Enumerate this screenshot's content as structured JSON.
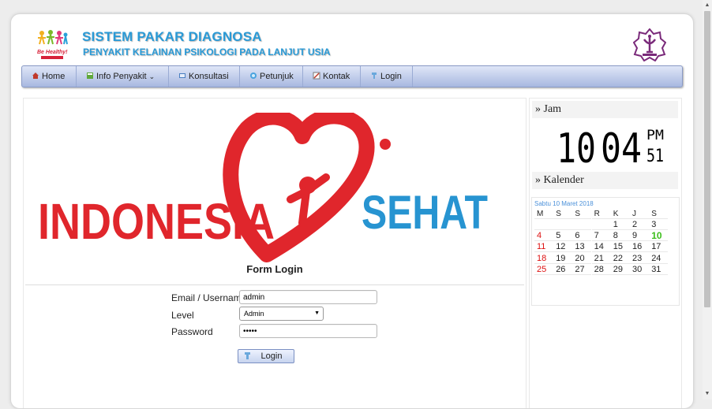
{
  "header": {
    "logo_left_text": "Be Healthy!",
    "title": "SISTEM PAKAR DIAGNOSA",
    "subtitle": "PENYAKIT KELAINAN PSIKOLOGI PADA LANJUT USIA"
  },
  "nav": {
    "items": [
      {
        "label": "Home",
        "icon": "home-icon"
      },
      {
        "label": "Info Penyakit",
        "icon": "info-icon",
        "has_dropdown": true
      },
      {
        "label": "Konsultasi",
        "icon": "chat-icon"
      },
      {
        "label": "Petunjuk",
        "icon": "help-icon"
      },
      {
        "label": "Kontak",
        "icon": "contact-icon"
      },
      {
        "label": "Login",
        "icon": "key-icon"
      }
    ]
  },
  "banner": {
    "left_text": "INDONESIA",
    "right_text": "SEHAT",
    "colors": {
      "red": "#e0262c",
      "blue": "#2794d1"
    }
  },
  "form": {
    "title": "Form Login",
    "email_label": "Email / Username",
    "email_value": "admin",
    "level_label": "Level",
    "level_value": "Admin",
    "password_label": "Password",
    "password_value": "•••••",
    "login_button": "Login"
  },
  "sidebar": {
    "clock_title": "» Jam",
    "clock": {
      "hours": "10",
      "minutes": "04",
      "ampm": "PM",
      "seconds": "51"
    },
    "calendar_title": "» Kalender",
    "calendar": {
      "caption": "Sabtu 10 Maret 2018",
      "weekdays": [
        "M",
        "S",
        "S",
        "R",
        "K",
        "J",
        "S"
      ],
      "weeks": [
        [
          "",
          "",
          "",
          "",
          "1",
          "2",
          "3"
        ],
        [
          "4",
          "5",
          "6",
          "7",
          "8",
          "9",
          "10"
        ],
        [
          "11",
          "12",
          "13",
          "14",
          "15",
          "16",
          "17"
        ],
        [
          "18",
          "19",
          "20",
          "21",
          "22",
          "23",
          "24"
        ],
        [
          "25",
          "26",
          "27",
          "28",
          "29",
          "30",
          "31"
        ]
      ],
      "today": "10"
    }
  }
}
